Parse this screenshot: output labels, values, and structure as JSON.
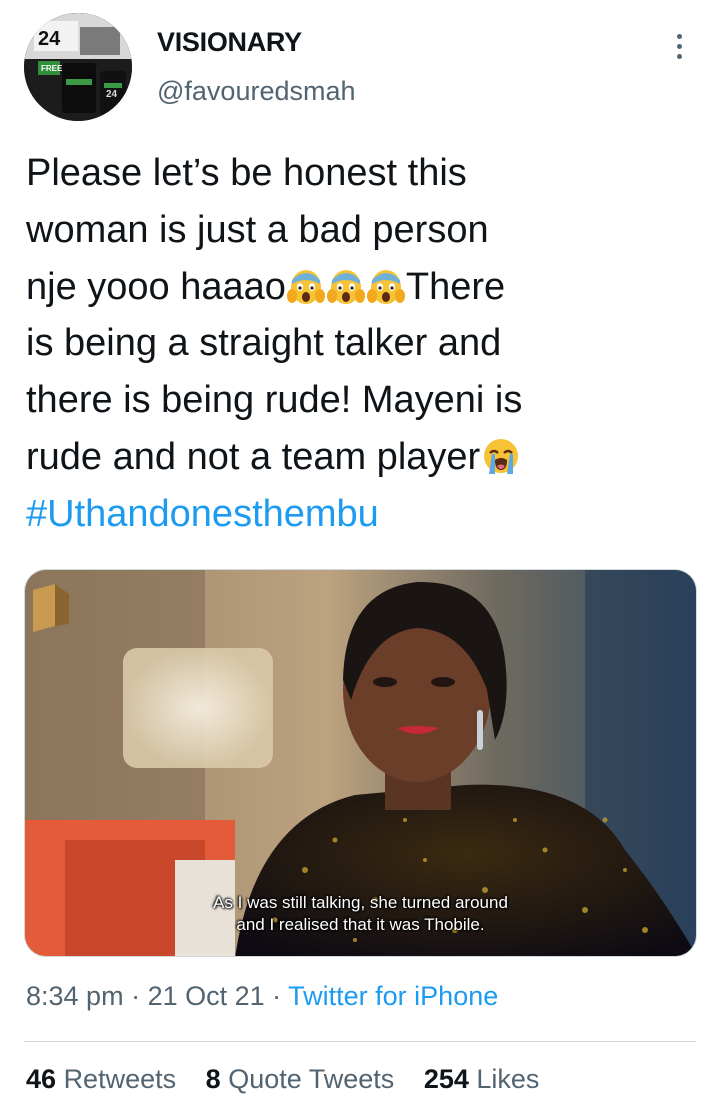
{
  "author": {
    "display_name": "VISIONARY",
    "handle": "@favouredsmah",
    "avatar_text": [
      "24",
      "FREE",
      "24"
    ]
  },
  "tweet": {
    "line1": "Please let’s be honest this",
    "line2": "woman is just a bad person",
    "line3_text": "nje yooo haaao",
    "line3_after": "There",
    "line4": "is being a straight talker and",
    "line5": "there is being rude! Mayeni is",
    "line6": "rude and not a team player",
    "hashtag": "#Uthandonesthembu",
    "emojis": [
      "face-screaming-in-fear",
      "face-screaming-in-fear",
      "face-screaming-in-fear",
      "loudly-crying-face"
    ]
  },
  "media": {
    "subtitle_line1": "As I was still talking, she turned around",
    "subtitle_line2": "and I realised that it was Thobile."
  },
  "meta": {
    "time": "8:34 pm",
    "separator1": " · ",
    "date": "21 Oct 21",
    "separator2": " · ",
    "source": "Twitter for iPhone"
  },
  "stats": {
    "retweets_count": "46",
    "retweets_label": "Retweets",
    "quotes_count": "8",
    "quotes_label": "Quote Tweets",
    "likes_count": "254",
    "likes_label": "Likes"
  },
  "colors": {
    "link": "#1d9bf0",
    "secondary_text": "#536471",
    "primary_text": "#0f1419"
  }
}
